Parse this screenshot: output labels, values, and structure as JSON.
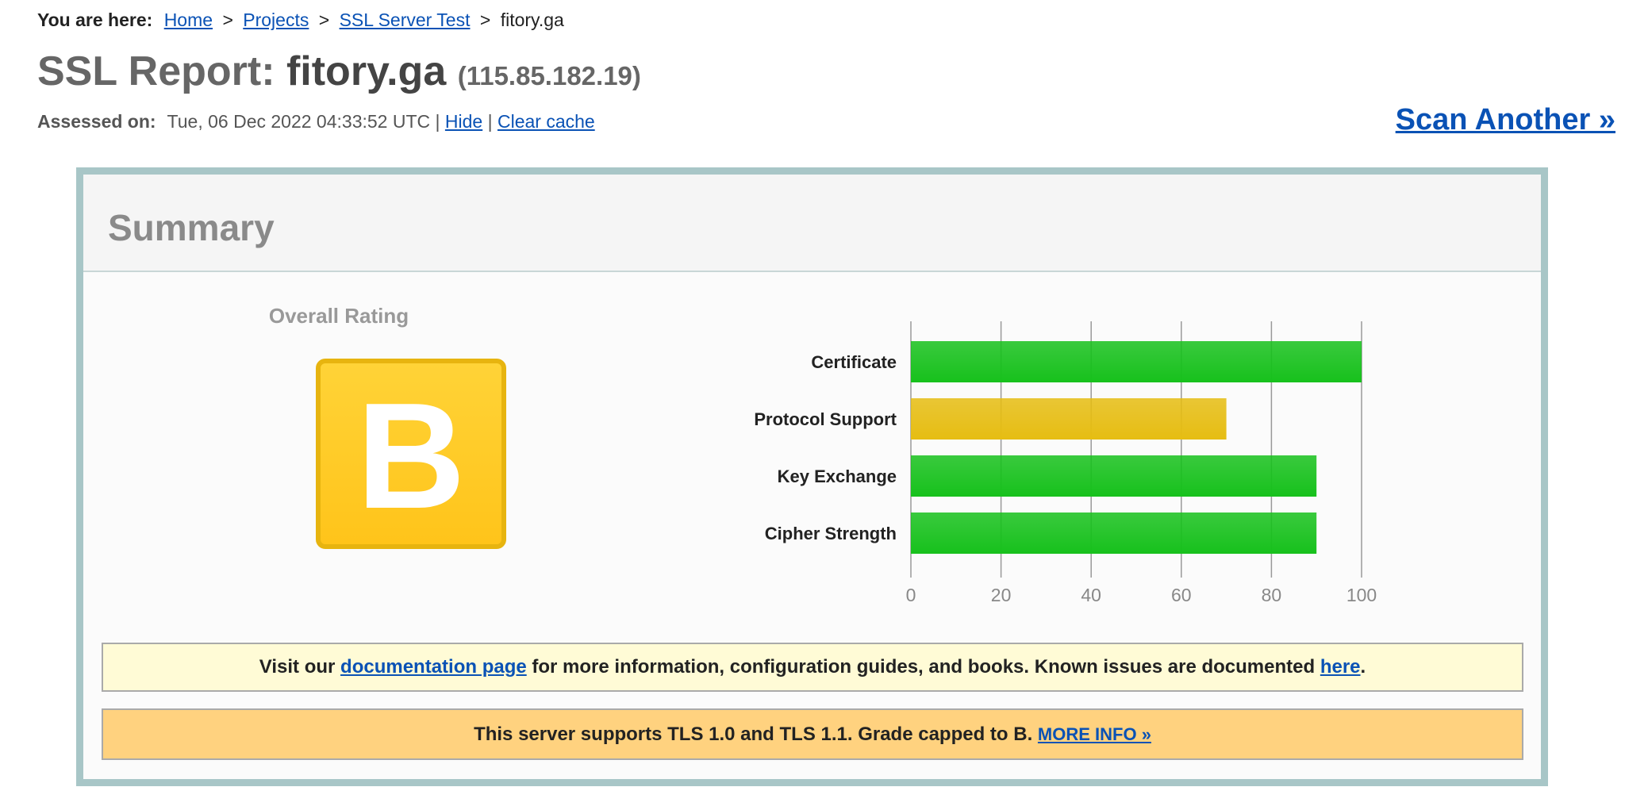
{
  "breadcrumb": {
    "label": "You are here:",
    "items": [
      "Home",
      "Projects",
      "SSL Server Test"
    ],
    "current": "fitory.ga",
    "separator": ">"
  },
  "title": {
    "prefix": "SSL Report:",
    "host": "fitory.ga",
    "ip": "(115.85.182.19)"
  },
  "assessed": {
    "label": "Assessed on:",
    "value": "Tue, 06 Dec 2022 04:33:52 UTC",
    "separator": "|",
    "hide": "Hide",
    "clear_cache": "Clear cache"
  },
  "scan_another": "Scan Another »",
  "summary": {
    "heading": "Summary",
    "overall_rating_label": "Overall Rating",
    "grade": "B",
    "grade_color": "#ffc41a"
  },
  "chart_data": {
    "type": "bar",
    "orientation": "horizontal",
    "categories": [
      "Certificate",
      "Protocol Support",
      "Key Exchange",
      "Cipher Strength"
    ],
    "values": [
      100,
      70,
      90,
      90
    ],
    "colors": [
      "#17c11c",
      "#e6bd12",
      "#17c11c",
      "#17c11c"
    ],
    "xlim": [
      0,
      100
    ],
    "ticks": [
      0,
      20,
      40,
      60,
      80,
      100
    ],
    "grid": true
  },
  "notices": {
    "docs": {
      "before": "Visit our",
      "link1": "documentation page",
      "middle": "for more information, configuration guides, and books. Known issues are documented",
      "link2": "here",
      "after": "."
    },
    "warn": {
      "text": "This server supports TLS 1.0 and TLS 1.1. Grade capped to B.",
      "link": "MORE INFO »"
    }
  }
}
